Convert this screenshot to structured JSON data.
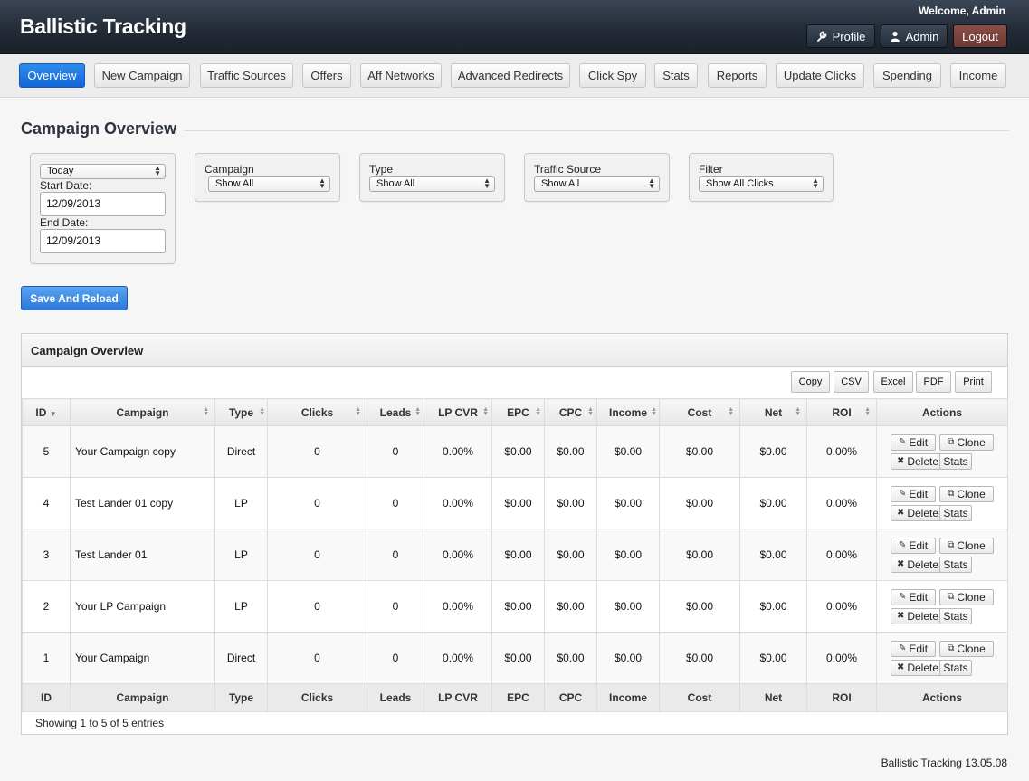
{
  "header": {
    "brand": "Ballistic Tracking",
    "welcome": "Welcome, Admin",
    "profile_label": "Profile",
    "admin_label": "Admin",
    "logout_label": "Logout"
  },
  "nav": {
    "items": [
      "Overview",
      "New Campaign",
      "Traffic Sources",
      "Offers",
      "Aff Networks",
      "Advanced Redirects",
      "Click Spy",
      "Stats",
      "Reports",
      "Update Clicks",
      "Spending",
      "Income"
    ],
    "active": "Overview"
  },
  "page": {
    "title": "Campaign Overview"
  },
  "filters": {
    "date_range": "Today",
    "start_label": "Start Date:",
    "start_value": "12/09/2013",
    "end_label": "End Date:",
    "end_value": "12/09/2013",
    "campaign_label": "Campaign",
    "campaign_value": "Show All",
    "type_label": "Type",
    "type_value": "Show All",
    "source_label": "Traffic Source",
    "source_value": "Show All",
    "filter_label": "Filter",
    "filter_value": "Show All Clicks",
    "save_label": "Save And Reload"
  },
  "panel": {
    "title": "Campaign Overview",
    "toolbar": [
      "Copy",
      "CSV",
      "Excel",
      "PDF",
      "Print"
    ],
    "columns": [
      "ID",
      "Campaign",
      "Type",
      "Clicks",
      "Leads",
      "LP CVR",
      "EPC",
      "CPC",
      "Income",
      "Cost",
      "Net",
      "ROI",
      "Actions"
    ],
    "rows": [
      {
        "id": "5",
        "campaign": "Your Campaign copy",
        "type": "Direct",
        "clicks": "0",
        "leads": "0",
        "lp_cvr": "0.00%",
        "epc": "$0.00",
        "cpc": "$0.00",
        "income": "$0.00",
        "cost": "$0.00",
        "net": "$0.00",
        "roi": "0.00%"
      },
      {
        "id": "4",
        "campaign": "Test Lander 01 copy",
        "type": "LP",
        "clicks": "0",
        "leads": "0",
        "lp_cvr": "0.00%",
        "epc": "$0.00",
        "cpc": "$0.00",
        "income": "$0.00",
        "cost": "$0.00",
        "net": "$0.00",
        "roi": "0.00%"
      },
      {
        "id": "3",
        "campaign": "Test Lander 01",
        "type": "LP",
        "clicks": "0",
        "leads": "0",
        "lp_cvr": "0.00%",
        "epc": "$0.00",
        "cpc": "$0.00",
        "income": "$0.00",
        "cost": "$0.00",
        "net": "$0.00",
        "roi": "0.00%"
      },
      {
        "id": "2",
        "campaign": "Your LP Campaign",
        "type": "LP",
        "clicks": "0",
        "leads": "0",
        "lp_cvr": "0.00%",
        "epc": "$0.00",
        "cpc": "$0.00",
        "income": "$0.00",
        "cost": "$0.00",
        "net": "$0.00",
        "roi": "0.00%"
      },
      {
        "id": "1",
        "campaign": "Your Campaign",
        "type": "Direct",
        "clicks": "0",
        "leads": "0",
        "lp_cvr": "0.00%",
        "epc": "$0.00",
        "cpc": "$0.00",
        "income": "$0.00",
        "cost": "$0.00",
        "net": "$0.00",
        "roi": "0.00%"
      }
    ],
    "actions": {
      "edit": "Edit",
      "clone": "Clone",
      "delete": "Delete",
      "stats": "Stats"
    },
    "showing": "Showing 1 to 5 of 5 entries"
  },
  "footer": {
    "version": "Ballistic Tracking 13.05.08"
  },
  "icons": {
    "profile": "wrench-icon",
    "admin": "user-icon",
    "edit": "pencil-icon",
    "clone": "copy-icon",
    "delete": "x-icon",
    "sort": "sort-arrows-icon"
  },
  "colors": {
    "accent": "#1a73e0",
    "logout": "#7a433c",
    "topbar": "#222a35"
  }
}
